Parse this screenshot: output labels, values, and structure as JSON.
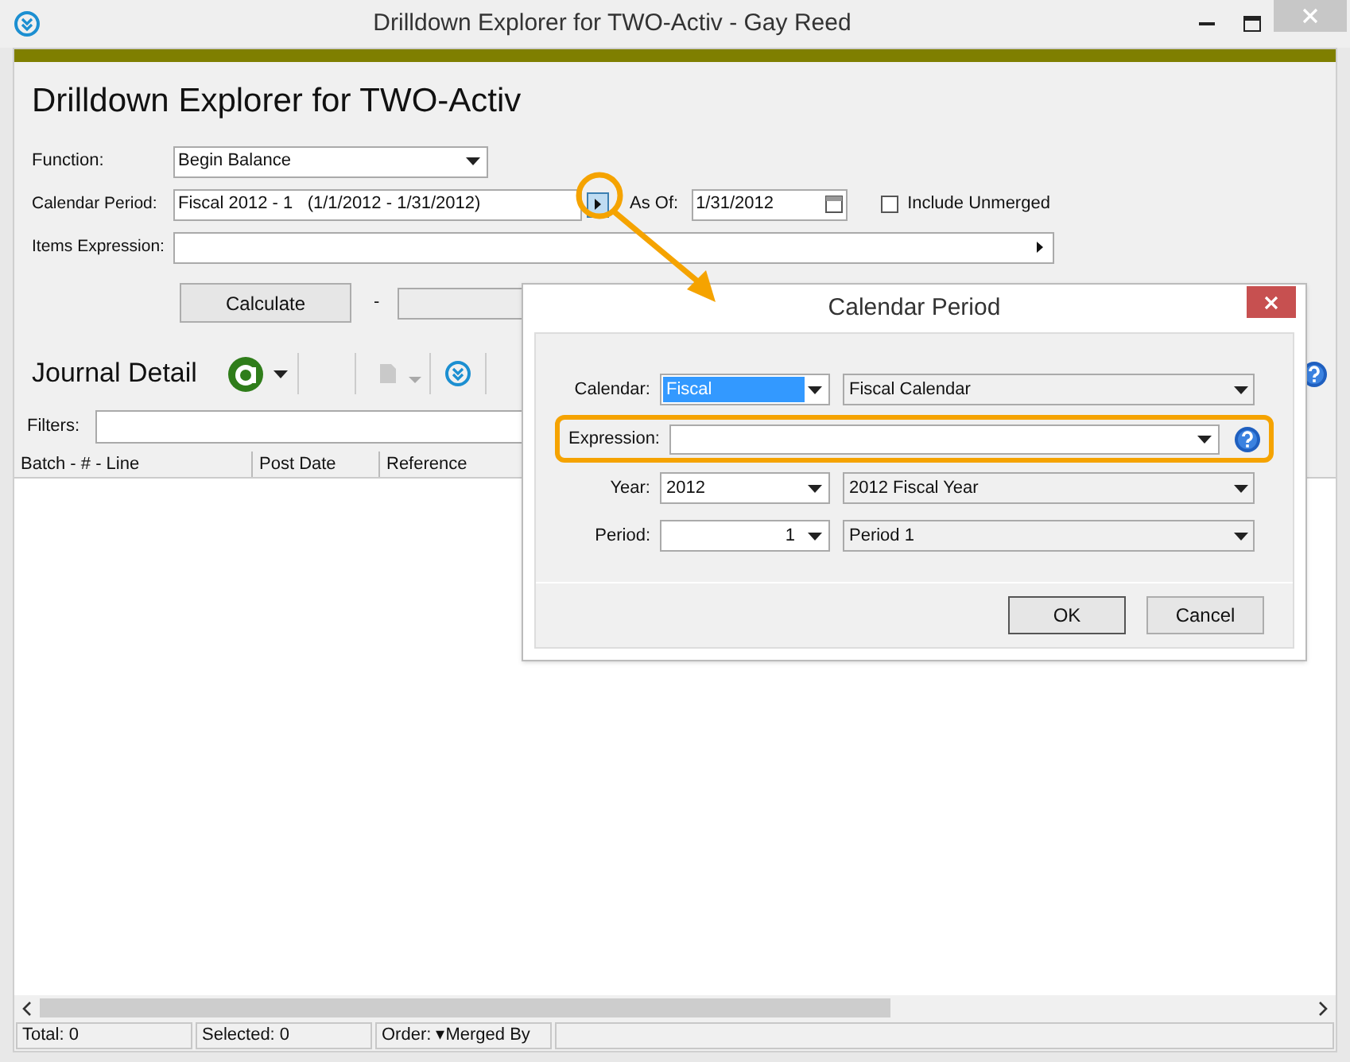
{
  "window": {
    "title": "Drilldown Explorer for TWO-Activ - Gay Reed"
  },
  "app_title": "Drilldown Explorer for TWO-Activ",
  "form": {
    "function": {
      "label": "Function:",
      "value": "Begin Balance"
    },
    "calendar_period": {
      "label": "Calendar Period:",
      "value": "Fiscal 2012 - 1   (1/1/2012 - 1/31/2012)"
    },
    "as_of": {
      "label": "As Of:",
      "value": "1/31/2012"
    },
    "include_unmerged": {
      "label": "Include Unmerged",
      "checked": false
    },
    "items_expression": {
      "label": "Items Expression:"
    },
    "calculate": "Calculate",
    "separator": "-"
  },
  "journal": {
    "title": "Journal Detail",
    "filters_label": "Filters:"
  },
  "table": {
    "columns": [
      "Batch - # - Line",
      "Post Date",
      "Reference"
    ]
  },
  "status_bar": [
    "Total: 0",
    "Selected: 0",
    "Order: ▾Merged By"
  ],
  "dialog": {
    "title": "Calendar Period",
    "rows": [
      {
        "kind": "pair",
        "label": "Calendar:",
        "value": "Fiscal",
        "selected": true,
        "description": "Fiscal Calendar"
      },
      {
        "kind": "expression",
        "label": "Expression:"
      },
      {
        "kind": "pair",
        "label": "Year:",
        "value": "2012",
        "selected": false,
        "description": "2012 Fiscal Year"
      },
      {
        "kind": "numeric",
        "label": "Period:",
        "value": "1",
        "selected": false,
        "description": "Period 1"
      }
    ],
    "buttons": [
      "OK",
      "Cancel"
    ]
  }
}
